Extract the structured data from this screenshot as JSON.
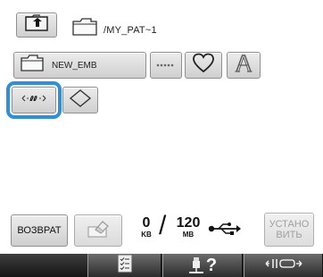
{
  "header": {
    "up_icon": "folder-up-icon",
    "folder_icon": "folder-icon",
    "path": "/MY_PAT~1"
  },
  "items": {
    "folder_name": "NEW_EMB",
    "folder_icon": "folder-icon",
    "small_font_icon": "small-font-dots-icon",
    "heart_icon": "heart-outline-icon",
    "letter_a_icon": "letter-a-icon",
    "arrow_pattern_icon": "arrow-pattern-icon",
    "diamond_icon": "diamond-outline-icon"
  },
  "bottom": {
    "back_label": "ВОЗВРАТ",
    "eraser_icon": "eraser-delete-icon",
    "used_value": "0",
    "used_unit": "KB",
    "total_value": "120",
    "total_unit": "MB",
    "usb_icon": "usb-icon",
    "install_label_line1": "УСТАНО",
    "install_label_line2": "ВИТЬ"
  },
  "statusbar": {
    "list_icon": "checklist-icon",
    "help_icon": "machine-help-icon",
    "help_mark": "?",
    "needle_icon": "needle-mode-icon"
  },
  "colors": {
    "selection": "#2f8fd8",
    "button": "#dddddd",
    "statusbar": "#222222"
  }
}
